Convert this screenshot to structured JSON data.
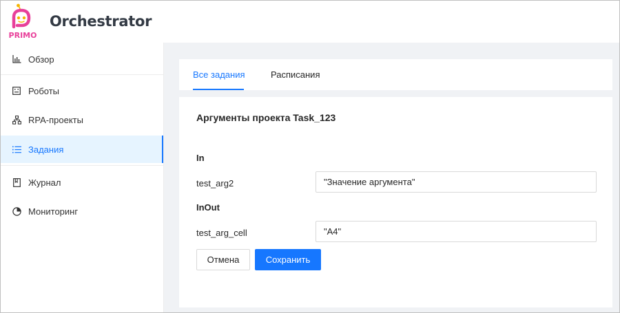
{
  "header": {
    "logo_text": "PRIMO",
    "title": "Orchestrator"
  },
  "sidebar": {
    "items": [
      {
        "label": "Обзор",
        "icon": "bar-chart-icon"
      },
      {
        "label": "Роботы",
        "icon": "robot-icon"
      },
      {
        "label": "RPA-проекты",
        "icon": "cluster-icon"
      },
      {
        "label": "Задания",
        "icon": "list-icon",
        "active": true
      },
      {
        "label": "Журнал",
        "icon": "book-icon"
      },
      {
        "label": "Мониторинг",
        "icon": "pie-chart-icon"
      }
    ]
  },
  "tabs": [
    {
      "label": "Все задания",
      "active": true
    },
    {
      "label": "Расписания",
      "active": false
    }
  ],
  "form": {
    "title": "Аргументы проекта Task_123",
    "sections": [
      {
        "label": "In",
        "args": [
          {
            "name": "test_arg2",
            "value": "\"Значение аргумента\""
          }
        ]
      },
      {
        "label": "InOut",
        "args": [
          {
            "name": "test_arg_cell",
            "value": "\"A4\""
          }
        ]
      }
    ],
    "cancel_label": "Отмена",
    "save_label": "Сохранить"
  },
  "colors": {
    "accent": "#1677ff",
    "active_bg": "#e6f4ff",
    "page_bg": "#f0f2f5",
    "logo_pink": "#e8409a",
    "logo_gold": "#f5b400"
  }
}
